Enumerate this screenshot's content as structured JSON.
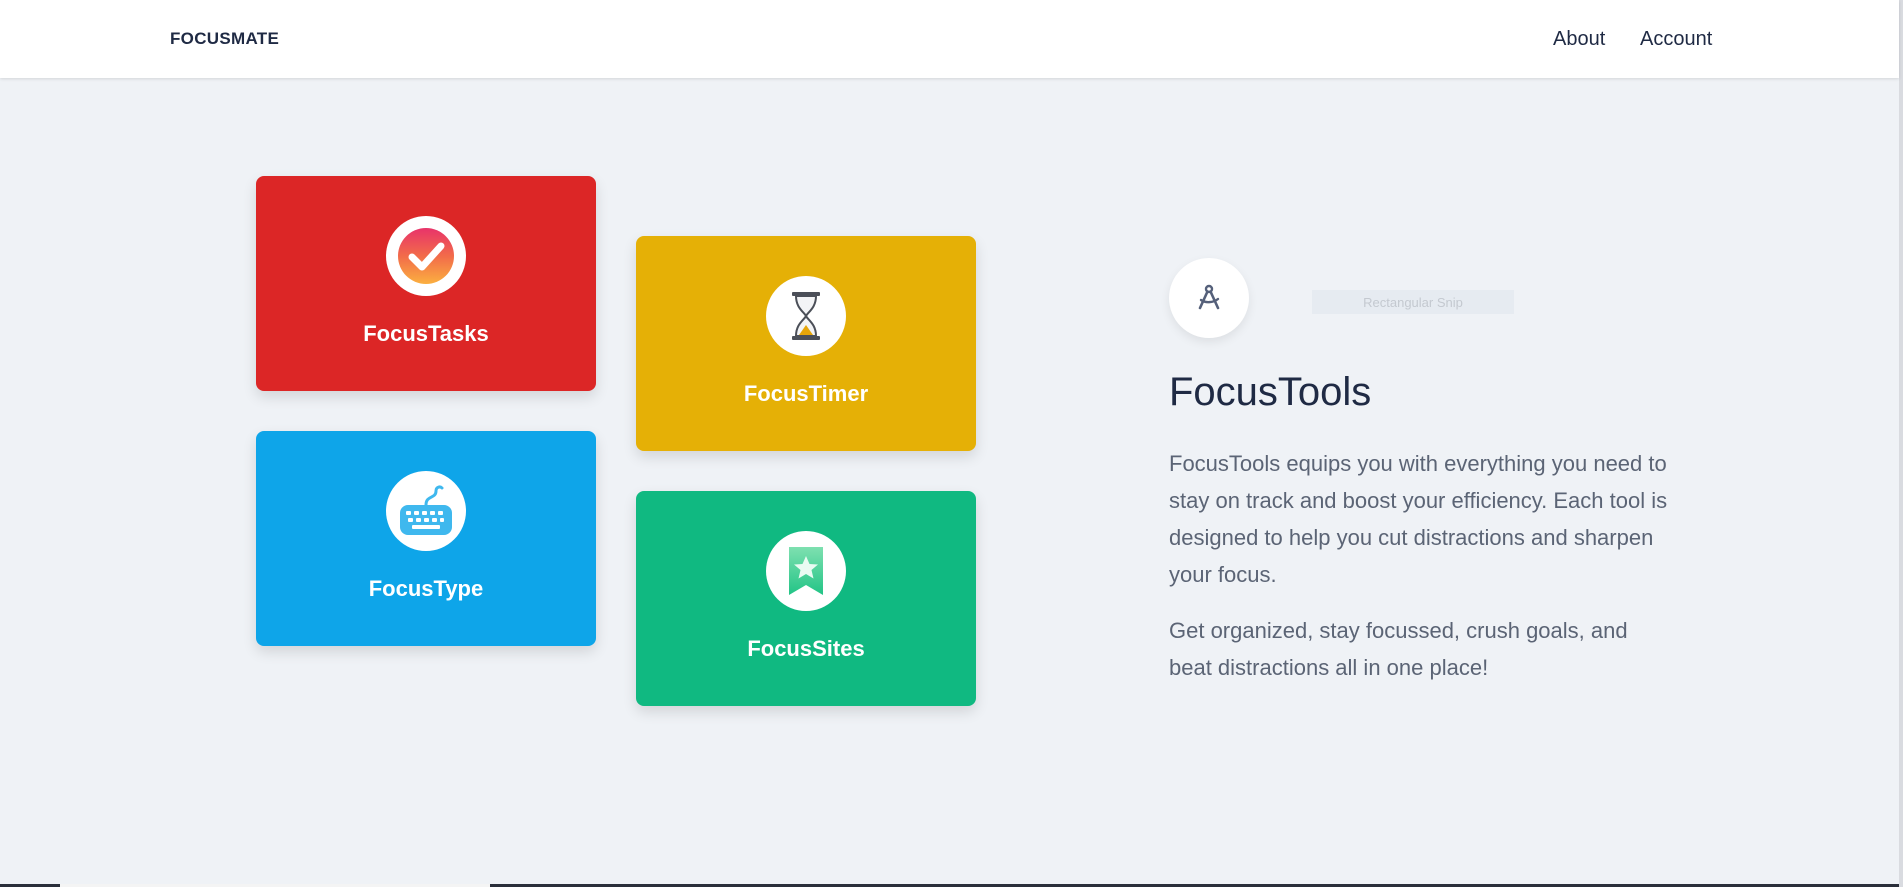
{
  "nav": {
    "brand": "FOCUSMATE",
    "links": [
      "About",
      "Account"
    ]
  },
  "tools": [
    {
      "label": "FocusTasks",
      "icon": "checkmark-icon",
      "color": "#dc2626"
    },
    {
      "label": "FocusTimer",
      "icon": "hourglass-icon",
      "color": "#e5b006"
    },
    {
      "label": "FocusType",
      "icon": "keyboard-icon",
      "color": "#0ea5e9"
    },
    {
      "label": "FocusSites",
      "icon": "bookmark-star-icon",
      "color": "#10b981"
    }
  ],
  "section": {
    "icon": "compass-tools-icon",
    "snip_label": "Rectangular Snip",
    "title": "FocusTools",
    "paragraphs": [
      "FocusTools equips you with everything you need to stay on track and boost your efficiency. Each tool is designed to help you cut distractions and sharpen your focus.",
      "Get organized, stay focussed, crush goals, and beat distractions all in one place!"
    ]
  }
}
